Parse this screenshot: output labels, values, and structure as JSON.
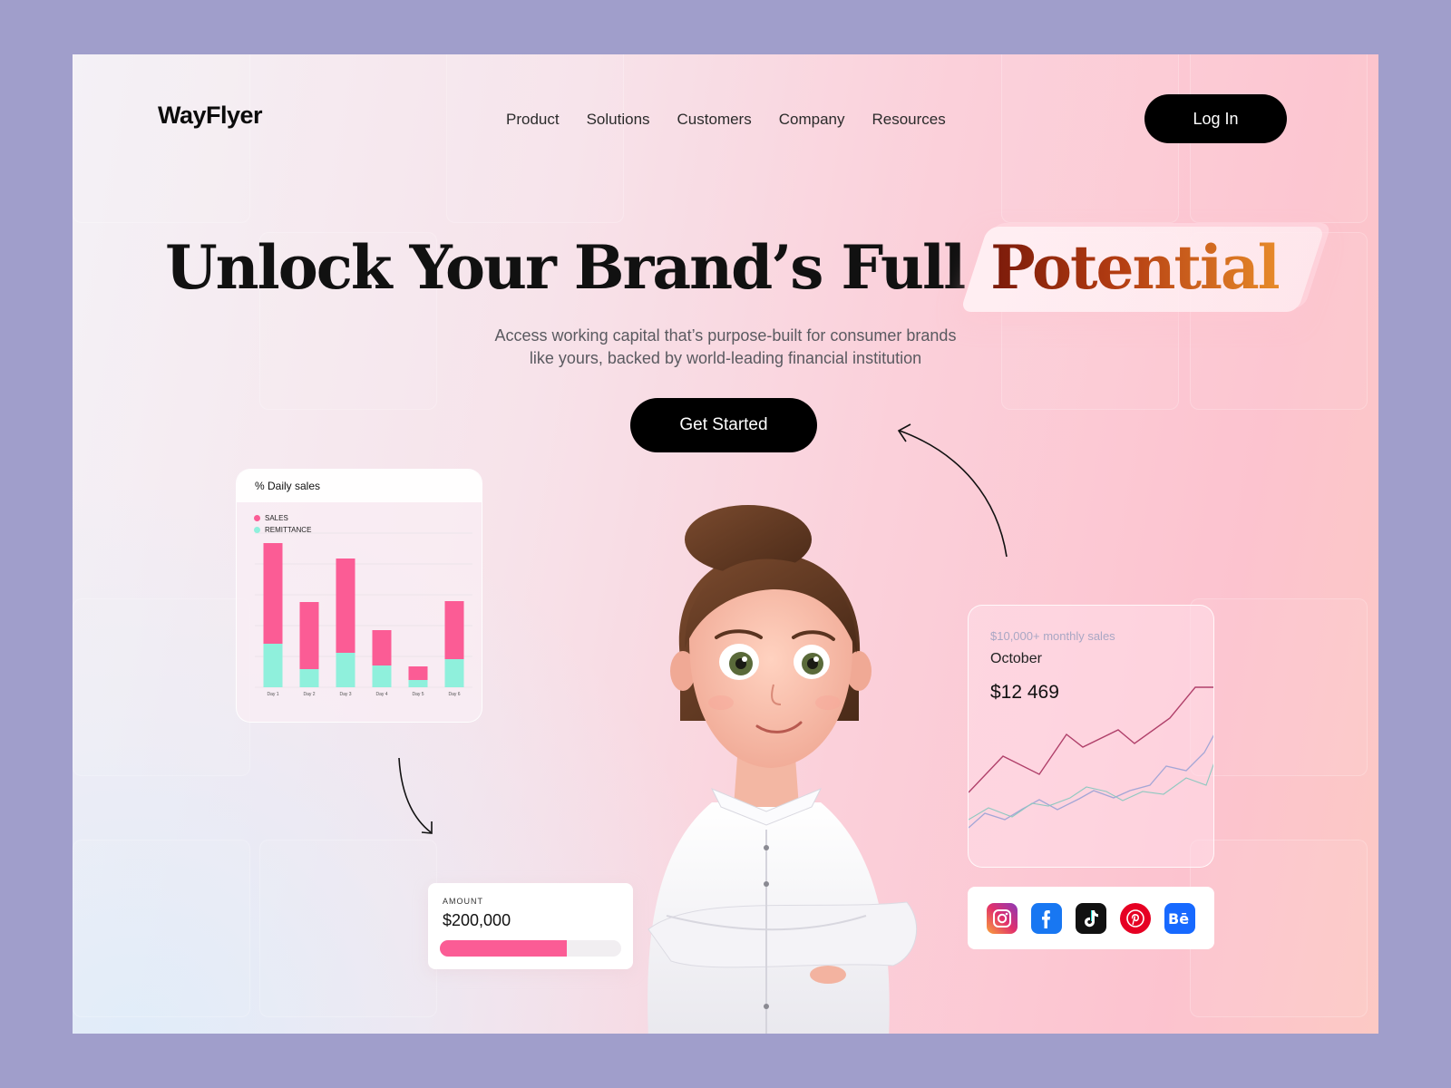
{
  "nav": {
    "logo": "WayFlyer",
    "items": [
      {
        "label": "Product"
      },
      {
        "label": "Solutions"
      },
      {
        "label": "Customers"
      },
      {
        "label": "Company"
      },
      {
        "label": "Resources"
      }
    ],
    "login_label": "Log In"
  },
  "hero": {
    "title_main": "Unlock Your Brand’s Full ",
    "title_highlight": "Potential",
    "subtitle_line1": "Access working capital that’s purpose-built for consumer brands",
    "subtitle_line2": "like yours, backed by world-leading financial institution",
    "cta_label": "Get Started"
  },
  "daily_sales_card": {
    "title": "% Daily sales",
    "legend": [
      {
        "label": "SALES",
        "color": "#fb5c95"
      },
      {
        "label": "REMITTANCE",
        "color": "#8ff0dc"
      }
    ]
  },
  "chart_data": {
    "type": "bar",
    "stacked": true,
    "categories": [
      "Day 1",
      "Day 2",
      "Day 3",
      "Day 4",
      "Day 5",
      "Day 6"
    ],
    "series": [
      {
        "name": "REMITTANCE",
        "color": "#8ff0dc",
        "values": [
          48,
          20,
          38,
          24,
          8,
          31
        ]
      },
      {
        "name": "SALES",
        "color": "#fb5c95",
        "values": [
          111,
          74,
          104,
          39,
          15,
          64
        ]
      }
    ],
    "ylim": [
      0,
      170
    ],
    "grid": true,
    "legend": "top-left"
  },
  "amount_card": {
    "label": "AMOUNT",
    "value": "$200,000",
    "progress_fraction": 0.7
  },
  "monthly_card": {
    "subtitle": "$10,000+ monthly sales",
    "month": "October",
    "value": "$12 469"
  },
  "social_icons": [
    {
      "name": "instagram-icon",
      "color": "#e1306c"
    },
    {
      "name": "facebook-icon",
      "color": "#1877f2"
    },
    {
      "name": "tiktok-icon",
      "color": "#111111"
    },
    {
      "name": "pinterest-icon",
      "color": "#e60023"
    },
    {
      "name": "behance-icon",
      "color": "#1769ff"
    }
  ],
  "colors": {
    "accent_pink": "#fb5c95",
    "accent_mint": "#8ff0dc",
    "button_black": "#000000",
    "background_outer": "#a09ecb"
  }
}
